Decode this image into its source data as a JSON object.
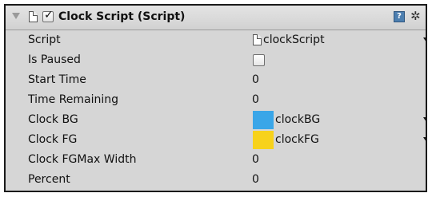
{
  "component": {
    "title": "Clock Script (Script)",
    "enabled_mark": "✓",
    "help_icon": "help-icon",
    "help_glyph": "?",
    "settings_icon": "gear-icon",
    "settings_glyph": "✲"
  },
  "fields": {
    "script": {
      "label": "Script",
      "value": "clockScript"
    },
    "is_paused": {
      "label": "Is Paused",
      "checked": false
    },
    "start_time": {
      "label": "Start Time",
      "value": "0"
    },
    "time_remaining": {
      "label": "Time Remaining",
      "value": "0"
    },
    "clock_bg": {
      "label": "Clock BG",
      "value": "clockBG",
      "color": "#3aa6e8"
    },
    "clock_fg": {
      "label": "Clock FG",
      "value": "clockFG",
      "color": "#f7d21b"
    },
    "clock_fg_max_width": {
      "label": "Clock FGMax Width",
      "value": "0"
    },
    "percent": {
      "label": "Percent",
      "value": "0"
    }
  }
}
